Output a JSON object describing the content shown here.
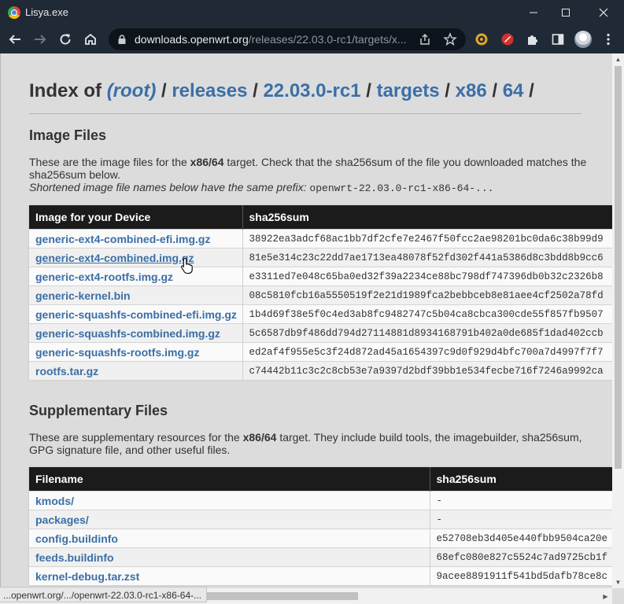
{
  "window": {
    "title": "Lisya.exe"
  },
  "address_bar": {
    "host": "downloads.openwrt.org",
    "path": "/releases/22.03.0-rc1/targets/x..."
  },
  "breadcrumb": {
    "prefix": "Index of",
    "sep": "/",
    "items": [
      "(root)",
      "releases",
      "22.03.0-rc1",
      "targets",
      "x86",
      "64"
    ]
  },
  "image_files": {
    "heading": "Image Files",
    "desc_1": "These are the image files for the",
    "desc_target": "x86/64",
    "desc_2": "target. Check that the sha256sum of the file you downloaded matches the sha256sum below.",
    "note": "Shortened image file names below have the same prefix:",
    "prefix": "openwrt-22.03.0-rc1-x86-64-...",
    "col_name": "Image for your Device",
    "col_sha": "sha256sum",
    "rows": [
      {
        "name": "generic-ext4-combined-efi.img.gz",
        "sha": "38922ea3adcf68ac1bb7df2cfe7e2467f50fcc2ae98201bc0da6c38b99d9"
      },
      {
        "name": "generic-ext4-combined.img.gz",
        "sha": "81e5e314c23c22dd7ae1713ea48078f52fd302f441a5386d8c3bdd8b9cc6"
      },
      {
        "name": "generic-ext4-rootfs.img.gz",
        "sha": "e3311ed7e048c65ba0ed32f39a2234ce88bc798df747396db0b32c2326b8"
      },
      {
        "name": "generic-kernel.bin",
        "sha": "08c5810fcb16a5550519f2e21d1989fca2bebbceb8e81aee4cf2502a78fd"
      },
      {
        "name": "generic-squashfs-combined-efi.img.gz",
        "sha": "1b4d69f38e5f0c4ed3ab8fc9482747c5b04ca8cbca300cde55f857fb9507"
      },
      {
        "name": "generic-squashfs-combined.img.gz",
        "sha": "5c6587db9f486dd794d27114881d8934168791b402a0de685f1dad402ccb"
      },
      {
        "name": "generic-squashfs-rootfs.img.gz",
        "sha": "ed2af4f955e5c3f24d872ad45a1654397c9d0f929d4bfc700a7d4997f7f7"
      },
      {
        "name": "rootfs.tar.gz",
        "sha": "c74442b11c3c2c8cb53e7a9397d2bdf39bb1e534fecbe716f7246a9992ca"
      }
    ]
  },
  "supplementary_files": {
    "heading": "Supplementary Files",
    "desc_1": "These are supplementary resources for the",
    "desc_target": "x86/64",
    "desc_2": "target. They include build tools, the imagebuilder, sha256sum, GPG signature file, and other useful files.",
    "col_name": "Filename",
    "col_sha": "sha256sum",
    "rows": [
      {
        "name": "kmods/",
        "sha": "-"
      },
      {
        "name": "packages/",
        "sha": "-"
      },
      {
        "name": "config.buildinfo",
        "sha": "e52708eb3d405e440fbb9504ca20e"
      },
      {
        "name": "feeds.buildinfo",
        "sha": "68efc080e827c5524c7ad9725cb1f"
      },
      {
        "name": "kernel-debug.tar.zst",
        "sha": "9acee8891911f541bd5dafb78ce8c"
      }
    ]
  },
  "status_bar": {
    "text": "...openwrt.org/.../openwrt-22.03.0-rc1-x86-64-..."
  },
  "colors": {
    "link": "#3b6fa6",
    "header_bg": "#1b1b1b",
    "chrome_bg": "#202a36"
  }
}
